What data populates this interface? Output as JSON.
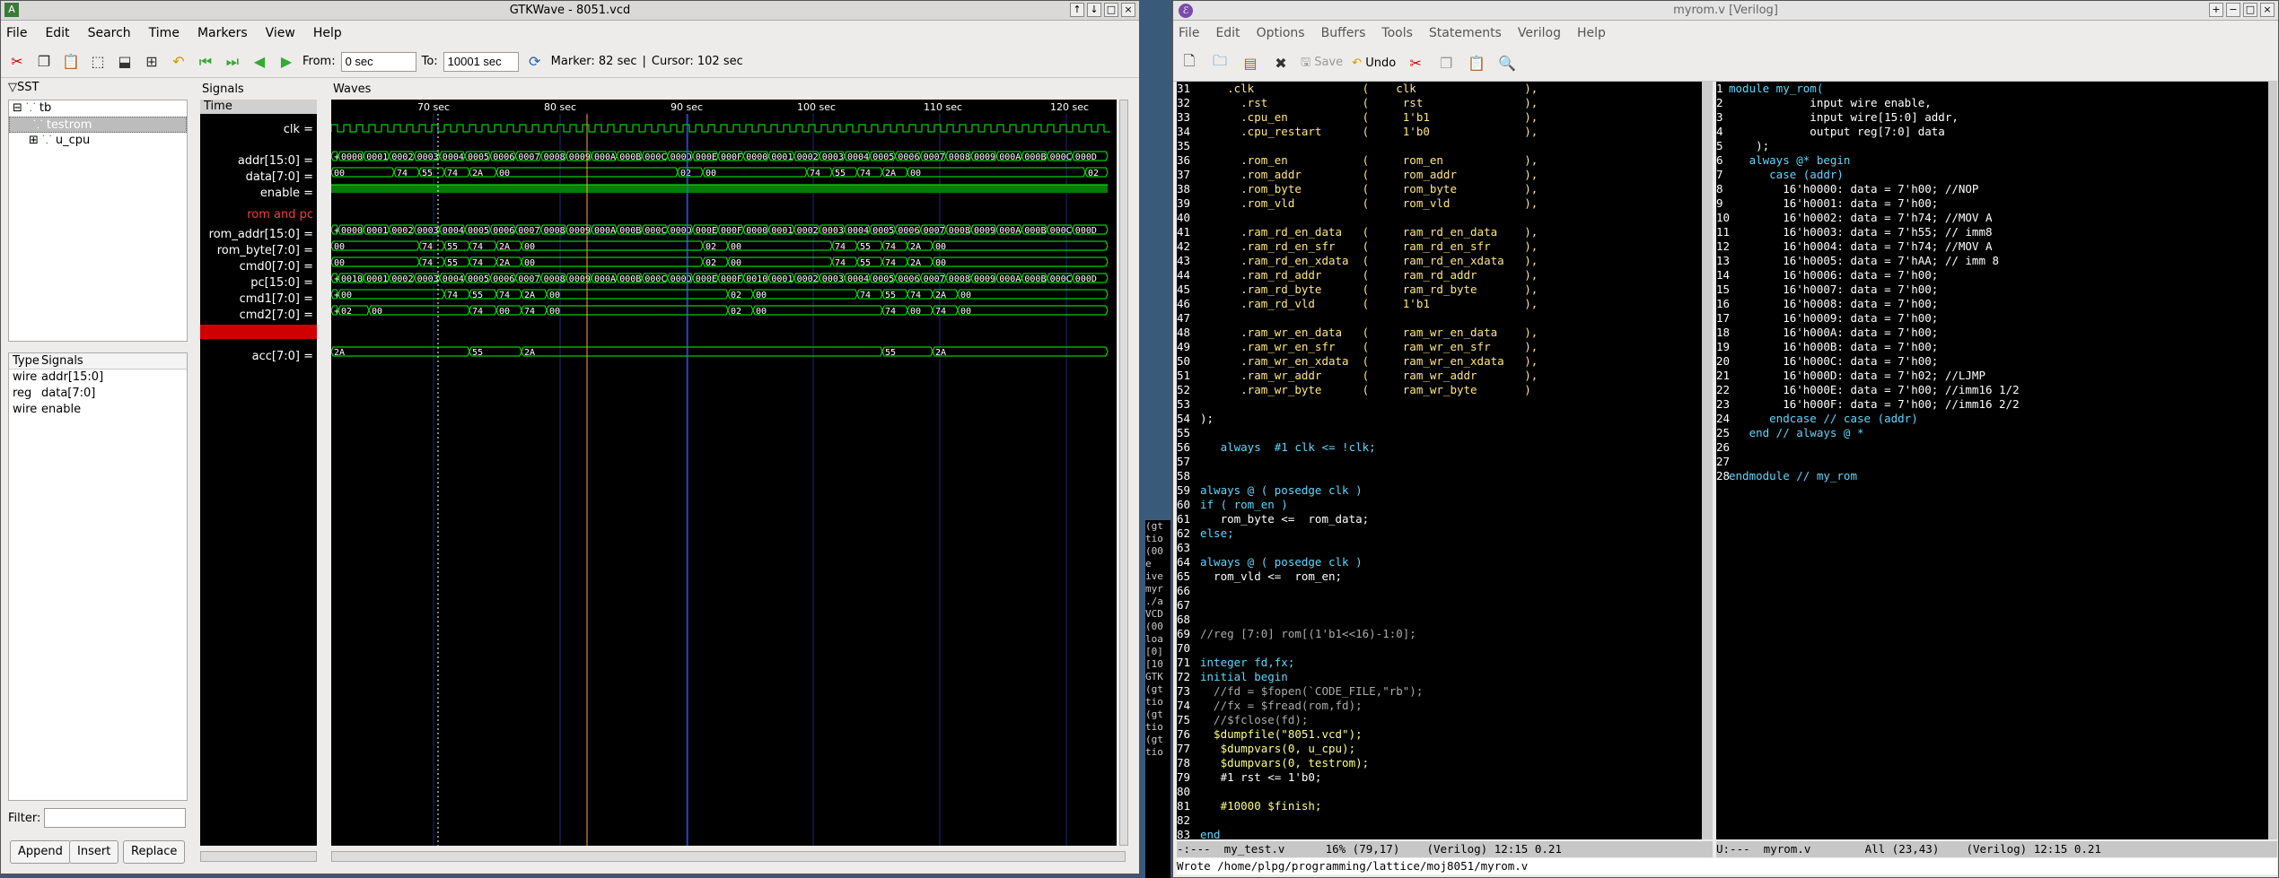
{
  "gtkwave": {
    "title": "GTKWave - 8051.vcd",
    "menu": [
      "File",
      "Edit",
      "Search",
      "Time",
      "Markers",
      "View",
      "Help"
    ],
    "from_label": "From:",
    "from_value": "0 sec",
    "to_label": "To:",
    "to_value": "10001 sec",
    "marker_label": "Marker: 82 sec",
    "sep": "|",
    "cursor_label": "Cursor: 102 sec",
    "sst_header": "SST",
    "tree": [
      "tb",
      "testrom",
      "u_cpu"
    ],
    "type_header": "Type",
    "signals_header": "Signals",
    "type_rows": [
      {
        "type": "wire",
        "sig": "addr[15:0]"
      },
      {
        "type": "reg",
        "sig": "data[7:0]"
      },
      {
        "type": "wire",
        "sig": "enable"
      }
    ],
    "filter_label": "Filter:",
    "buttons": [
      "Append",
      "Insert",
      "Replace"
    ],
    "signals_panel_title": "Signals",
    "waves_panel_title": "Waves",
    "time_label": "Time",
    "signal_names": [
      "clk =",
      "addr[15:0] =",
      "data[7:0] =",
      "enable =",
      "rom and pc",
      "rom_addr[15:0] =",
      "rom_byte[7:0] =",
      "cmd0[7:0] =",
      "pc[15:0] =",
      "cmd1[7:0] =",
      "cmd2[7:0] =",
      "",
      "acc[7:0] ="
    ],
    "time_ticks": [
      "70 sec",
      "80 sec",
      "90 sec",
      "100 sec",
      "110 sec",
      "120 sec"
    ],
    "addr_vals": [
      "+",
      "0000",
      "0001",
      "0002",
      "0003",
      "0004",
      "0005",
      "0006",
      "0007",
      "0008",
      "0009",
      "000A",
      "000B",
      "000C",
      "000D",
      "000E",
      "000F",
      "0000",
      "0001",
      "0002",
      "0003",
      "0004",
      "0005",
      "0006",
      "0007",
      "0008",
      "0009",
      "000A",
      "000B",
      "000C",
      "000D"
    ],
    "data_vals": [
      "00",
      "74",
      "55",
      "74",
      "2A",
      "00",
      "02",
      "00",
      "74",
      "55",
      "74",
      "2A",
      "00",
      "02"
    ],
    "rom_byte_vals": [
      "00",
      "74",
      "55",
      "74",
      "2A",
      "00",
      "02",
      "00",
      "74",
      "55",
      "74",
      "2A",
      "00"
    ],
    "cmd0_vals": [
      "00",
      "74",
      "55",
      "74",
      "2A",
      "00",
      "02",
      "00",
      "74",
      "55",
      "74",
      "2A",
      "00"
    ],
    "pc_vals": [
      "+",
      "0010",
      "0001",
      "0002",
      "0003",
      "0004",
      "0005",
      "0006",
      "0007",
      "0008",
      "0009",
      "000A",
      "000B",
      "000C",
      "000D",
      "000E",
      "000F",
      "0010",
      "0001",
      "0002",
      "0003",
      "0004",
      "0005",
      "0006",
      "0007",
      "0008",
      "0009",
      "000A",
      "000B",
      "000C",
      "000D"
    ],
    "cmd1_vals": [
      "+",
      "00",
      "74",
      "55",
      "74",
      "2A",
      "00",
      "02",
      "00",
      "74",
      "55",
      "74",
      "2A",
      "00"
    ],
    "cmd2_vals": [
      "+",
      "02",
      "00",
      "74",
      "00",
      "74",
      "00",
      "02",
      "00",
      "74",
      "00",
      "74",
      "00"
    ],
    "acc_vals": [
      "2A",
      "55",
      "2A",
      "55",
      "2A"
    ]
  },
  "emacs": {
    "title": "myrom.v [Verilog]",
    "menu": [
      "File",
      "Edit",
      "Options",
      "Buffers",
      "Tools",
      "Statements",
      "Verilog",
      "Help"
    ],
    "toolbar": {
      "save": "Save",
      "undo": "Undo"
    },
    "left_lines": [
      [
        "31",
        "    .clk                (    clk                ),"
      ],
      [
        "32",
        "      .rst              (     rst               ),"
      ],
      [
        "33",
        "      .cpu_en           (     1'b1              ),"
      ],
      [
        "34",
        "      .cpu_restart      (     1'b0              ),"
      ],
      [
        "35",
        ""
      ],
      [
        "36",
        "      .rom_en           (     rom_en            ),"
      ],
      [
        "37",
        "      .rom_addr         (     rom_addr          ),"
      ],
      [
        "38",
        "      .rom_byte         (     rom_byte          ),"
      ],
      [
        "39",
        "      .rom_vld          (     rom_vld           ),"
      ],
      [
        "40",
        ""
      ],
      [
        "41",
        "      .ram_rd_en_data   (     ram_rd_en_data    ),"
      ],
      [
        "42",
        "      .ram_rd_en_sfr    (     ram_rd_en_sfr     ),"
      ],
      [
        "43",
        "      .ram_rd_en_xdata  (     ram_rd_en_xdata   ),"
      ],
      [
        "44",
        "      .ram_rd_addr      (     ram_rd_addr       ),"
      ],
      [
        "45",
        "      .ram_rd_byte      (     ram_rd_byte       ),"
      ],
      [
        "46",
        "      .ram_rd_vld       (     1'b1              ),"
      ],
      [
        "47",
        ""
      ],
      [
        "48",
        "      .ram_wr_en_data   (     ram_wr_en_data    ),"
      ],
      [
        "49",
        "      .ram_wr_en_sfr    (     ram_wr_en_sfr     ),"
      ],
      [
        "50",
        "      .ram_wr_en_xdata  (     ram_wr_en_xdata   ),"
      ],
      [
        "51",
        "      .ram_wr_addr      (     ram_wr_addr       ),"
      ],
      [
        "52",
        "      .ram_wr_byte      (     ram_wr_byte       )"
      ],
      [
        "53",
        ""
      ],
      [
        "54",
        ");"
      ],
      [
        "55",
        ""
      ],
      [
        "56",
        "   always  #1 clk <= !clk;"
      ],
      [
        "57",
        ""
      ],
      [
        "58",
        ""
      ],
      [
        "59",
        "always @ ( posedge clk )"
      ],
      [
        "60",
        "if ( rom_en )"
      ],
      [
        "61",
        "   rom_byte <=  rom_data;"
      ],
      [
        "62",
        "else;"
      ],
      [
        "63",
        ""
      ],
      [
        "64",
        "always @ ( posedge clk )"
      ],
      [
        "65",
        "  rom_vld <=  rom_en;"
      ],
      [
        "66",
        ""
      ],
      [
        "67",
        ""
      ],
      [
        "68",
        ""
      ],
      [
        "69",
        "//reg [7:0] rom[(1'b1<<16)-1:0];"
      ],
      [
        "70",
        ""
      ],
      [
        "71",
        "integer fd,fx;"
      ],
      [
        "72",
        "initial begin"
      ],
      [
        "73",
        "  //fd = $fopen(`CODE_FILE,\"rb\");"
      ],
      [
        "74",
        "  //fx = $fread(rom,fd);"
      ],
      [
        "75",
        "  //$fclose(fd);"
      ],
      [
        "76",
        "  $dumpfile(\"8051.vcd\");"
      ],
      [
        "77",
        "   $dumpvars(0, u_cpu);"
      ],
      [
        "78",
        "   $dumpvars(0, testrom);"
      ],
      [
        "79",
        "   #1 rst <= 1'b0;"
      ],
      [
        "80",
        ""
      ],
      [
        "81",
        "   #10000 $finish;"
      ],
      [
        "82",
        ""
      ],
      [
        "83",
        "end"
      ]
    ],
    "right_lines": [
      [
        "1",
        "module my_rom("
      ],
      [
        "2",
        "            input wire enable,"
      ],
      [
        "3",
        "            input wire[15:0] addr,"
      ],
      [
        "4",
        "            output reg[7:0] data"
      ],
      [
        "5",
        "    );"
      ],
      [
        "6",
        "   always @* begin"
      ],
      [
        "7",
        "      case (addr)"
      ],
      [
        "8",
        "        16'h0000: data = 7'h00; //NOP"
      ],
      [
        "9",
        "        16'h0001: data = 7'h00;"
      ],
      [
        "10",
        "        16'h0002: data = 7'h74; //MOV A"
      ],
      [
        "11",
        "        16'h0003: data = 7'h55; // imm8"
      ],
      [
        "12",
        "        16'h0004: data = 7'h74; //MOV A"
      ],
      [
        "13",
        "        16'h0005: data = 7'hAA; // imm 8"
      ],
      [
        "14",
        "        16'h0006: data = 7'h00;"
      ],
      [
        "15",
        "        16'h0007: data = 7'h00;"
      ],
      [
        "16",
        "        16'h0008: data = 7'h00;"
      ],
      [
        "17",
        "        16'h0009: data = 7'h00;"
      ],
      [
        "18",
        "        16'h000A: data = 7'h00;"
      ],
      [
        "19",
        "        16'h000B: data = 7'h00;"
      ],
      [
        "20",
        "        16'h000C: data = 7'h00;"
      ],
      [
        "21",
        "        16'h000D: data = 7'h02; //LJMP"
      ],
      [
        "22",
        "        16'h000E: data = 7'h00; //imm16 1/2"
      ],
      [
        "23",
        "        16'h000F: data = 7'h00; //imm16 2/2"
      ],
      [
        "24",
        "      endcase // case (addr)"
      ],
      [
        "25",
        "   end // always @ *"
      ],
      [
        "26",
        ""
      ],
      [
        "27",
        ""
      ],
      [
        "28",
        "endmodule // my_rom"
      ]
    ],
    "modeline_left": "-:---  my_test.v      16% (79,17)    (Verilog) 12:15 0.21",
    "modeline_right": "U:---  myrom.v        All (23,43)    (Verilog) 12:15 0.21",
    "minibuffer": "Wrote /home/plpg/programming/lattice/moj8051/myrom.v"
  },
  "terminal_snippets": [
    "(gt",
    "tio",
    "(00",
    "e",
    "ive",
    "myr",
    "./a",
    "VCD",
    "(00",
    "loa",
    "[0]",
    "[10",
    "GTK",
    "(gt",
    "tio",
    "(gt",
    "tio",
    "(gt",
    "tio"
  ],
  "colors": {
    "wave_green": "#00ff00",
    "cursor_red": "#ff3030",
    "marker_orange": "#ffa040",
    "kw_cyan": "#5fd7ff",
    "kw_green": "#5fff5f",
    "ident_yellow": "#ffff80",
    "comment_gray": "#aaaaaa",
    "string_pink": "#ff80c0"
  }
}
